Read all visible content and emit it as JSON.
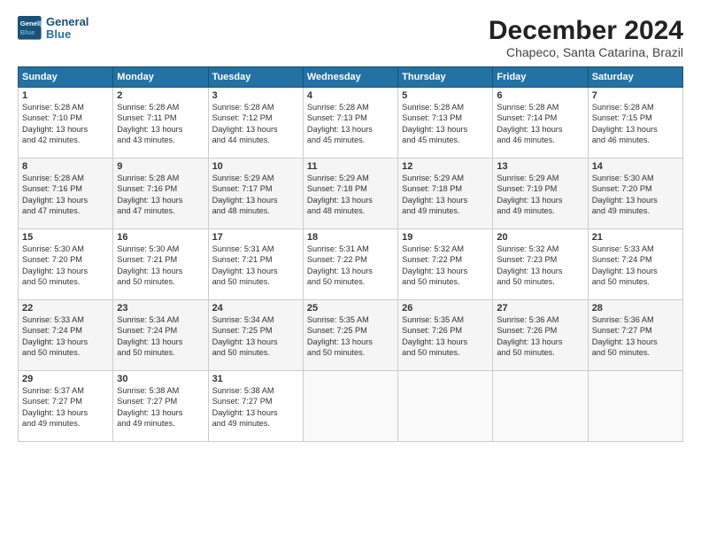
{
  "header": {
    "logo_line1": "General",
    "logo_line2": "Blue",
    "title": "December 2024",
    "subtitle": "Chapeco, Santa Catarina, Brazil"
  },
  "calendar": {
    "days_of_week": [
      "Sunday",
      "Monday",
      "Tuesday",
      "Wednesday",
      "Thursday",
      "Friday",
      "Saturday"
    ],
    "weeks": [
      [
        {
          "day": "",
          "info": ""
        },
        {
          "day": "2",
          "info": "Sunrise: 5:28 AM\nSunset: 7:11 PM\nDaylight: 13 hours\nand 43 minutes."
        },
        {
          "day": "3",
          "info": "Sunrise: 5:28 AM\nSunset: 7:12 PM\nDaylight: 13 hours\nand 44 minutes."
        },
        {
          "day": "4",
          "info": "Sunrise: 5:28 AM\nSunset: 7:13 PM\nDaylight: 13 hours\nand 45 minutes."
        },
        {
          "day": "5",
          "info": "Sunrise: 5:28 AM\nSunset: 7:13 PM\nDaylight: 13 hours\nand 45 minutes."
        },
        {
          "day": "6",
          "info": "Sunrise: 5:28 AM\nSunset: 7:14 PM\nDaylight: 13 hours\nand 46 minutes."
        },
        {
          "day": "7",
          "info": "Sunrise: 5:28 AM\nSunset: 7:15 PM\nDaylight: 13 hours\nand 46 minutes."
        }
      ],
      [
        {
          "day": "1",
          "info": "Sunrise: 5:28 AM\nSunset: 7:10 PM\nDaylight: 13 hours\nand 42 minutes.",
          "first": true
        },
        {
          "day": "8",
          "info": "Sunrise: 5:28 AM\nSunset: 7:16 PM\nDaylight: 13 hours\nand 47 minutes."
        },
        {
          "day": "9",
          "info": "Sunrise: 5:28 AM\nSunset: 7:16 PM\nDaylight: 13 hours\nand 47 minutes."
        },
        {
          "day": "10",
          "info": "Sunrise: 5:29 AM\nSunset: 7:17 PM\nDaylight: 13 hours\nand 48 minutes."
        },
        {
          "day": "11",
          "info": "Sunrise: 5:29 AM\nSunset: 7:18 PM\nDaylight: 13 hours\nand 48 minutes."
        },
        {
          "day": "12",
          "info": "Sunrise: 5:29 AM\nSunset: 7:18 PM\nDaylight: 13 hours\nand 49 minutes."
        },
        {
          "day": "13",
          "info": "Sunrise: 5:29 AM\nSunset: 7:19 PM\nDaylight: 13 hours\nand 49 minutes."
        },
        {
          "day": "14",
          "info": "Sunrise: 5:30 AM\nSunset: 7:20 PM\nDaylight: 13 hours\nand 49 minutes."
        }
      ],
      [
        {
          "day": "15",
          "info": "Sunrise: 5:30 AM\nSunset: 7:20 PM\nDaylight: 13 hours\nand 50 minutes."
        },
        {
          "day": "16",
          "info": "Sunrise: 5:30 AM\nSunset: 7:21 PM\nDaylight: 13 hours\nand 50 minutes."
        },
        {
          "day": "17",
          "info": "Sunrise: 5:31 AM\nSunset: 7:21 PM\nDaylight: 13 hours\nand 50 minutes."
        },
        {
          "day": "18",
          "info": "Sunrise: 5:31 AM\nSunset: 7:22 PM\nDaylight: 13 hours\nand 50 minutes."
        },
        {
          "day": "19",
          "info": "Sunrise: 5:32 AM\nSunset: 7:22 PM\nDaylight: 13 hours\nand 50 minutes."
        },
        {
          "day": "20",
          "info": "Sunrise: 5:32 AM\nSunset: 7:23 PM\nDaylight: 13 hours\nand 50 minutes."
        },
        {
          "day": "21",
          "info": "Sunrise: 5:33 AM\nSunset: 7:24 PM\nDaylight: 13 hours\nand 50 minutes."
        }
      ],
      [
        {
          "day": "22",
          "info": "Sunrise: 5:33 AM\nSunset: 7:24 PM\nDaylight: 13 hours\nand 50 minutes."
        },
        {
          "day": "23",
          "info": "Sunrise: 5:34 AM\nSunset: 7:24 PM\nDaylight: 13 hours\nand 50 minutes."
        },
        {
          "day": "24",
          "info": "Sunrise: 5:34 AM\nSunset: 7:25 PM\nDaylight: 13 hours\nand 50 minutes."
        },
        {
          "day": "25",
          "info": "Sunrise: 5:35 AM\nSunset: 7:25 PM\nDaylight: 13 hours\nand 50 minutes."
        },
        {
          "day": "26",
          "info": "Sunrise: 5:35 AM\nSunset: 7:26 PM\nDaylight: 13 hours\nand 50 minutes."
        },
        {
          "day": "27",
          "info": "Sunrise: 5:36 AM\nSunset: 7:26 PM\nDaylight: 13 hours\nand 50 minutes."
        },
        {
          "day": "28",
          "info": "Sunrise: 5:36 AM\nSunset: 7:27 PM\nDaylight: 13 hours\nand 50 minutes."
        }
      ],
      [
        {
          "day": "29",
          "info": "Sunrise: 5:37 AM\nSunset: 7:27 PM\nDaylight: 13 hours\nand 49 minutes."
        },
        {
          "day": "30",
          "info": "Sunrise: 5:38 AM\nSunset: 7:27 PM\nDaylight: 13 hours\nand 49 minutes."
        },
        {
          "day": "31",
          "info": "Sunrise: 5:38 AM\nSunset: 7:27 PM\nDaylight: 13 hours\nand 49 minutes."
        },
        {
          "day": "",
          "info": ""
        },
        {
          "day": "",
          "info": ""
        },
        {
          "day": "",
          "info": ""
        },
        {
          "day": "",
          "info": ""
        }
      ]
    ]
  }
}
